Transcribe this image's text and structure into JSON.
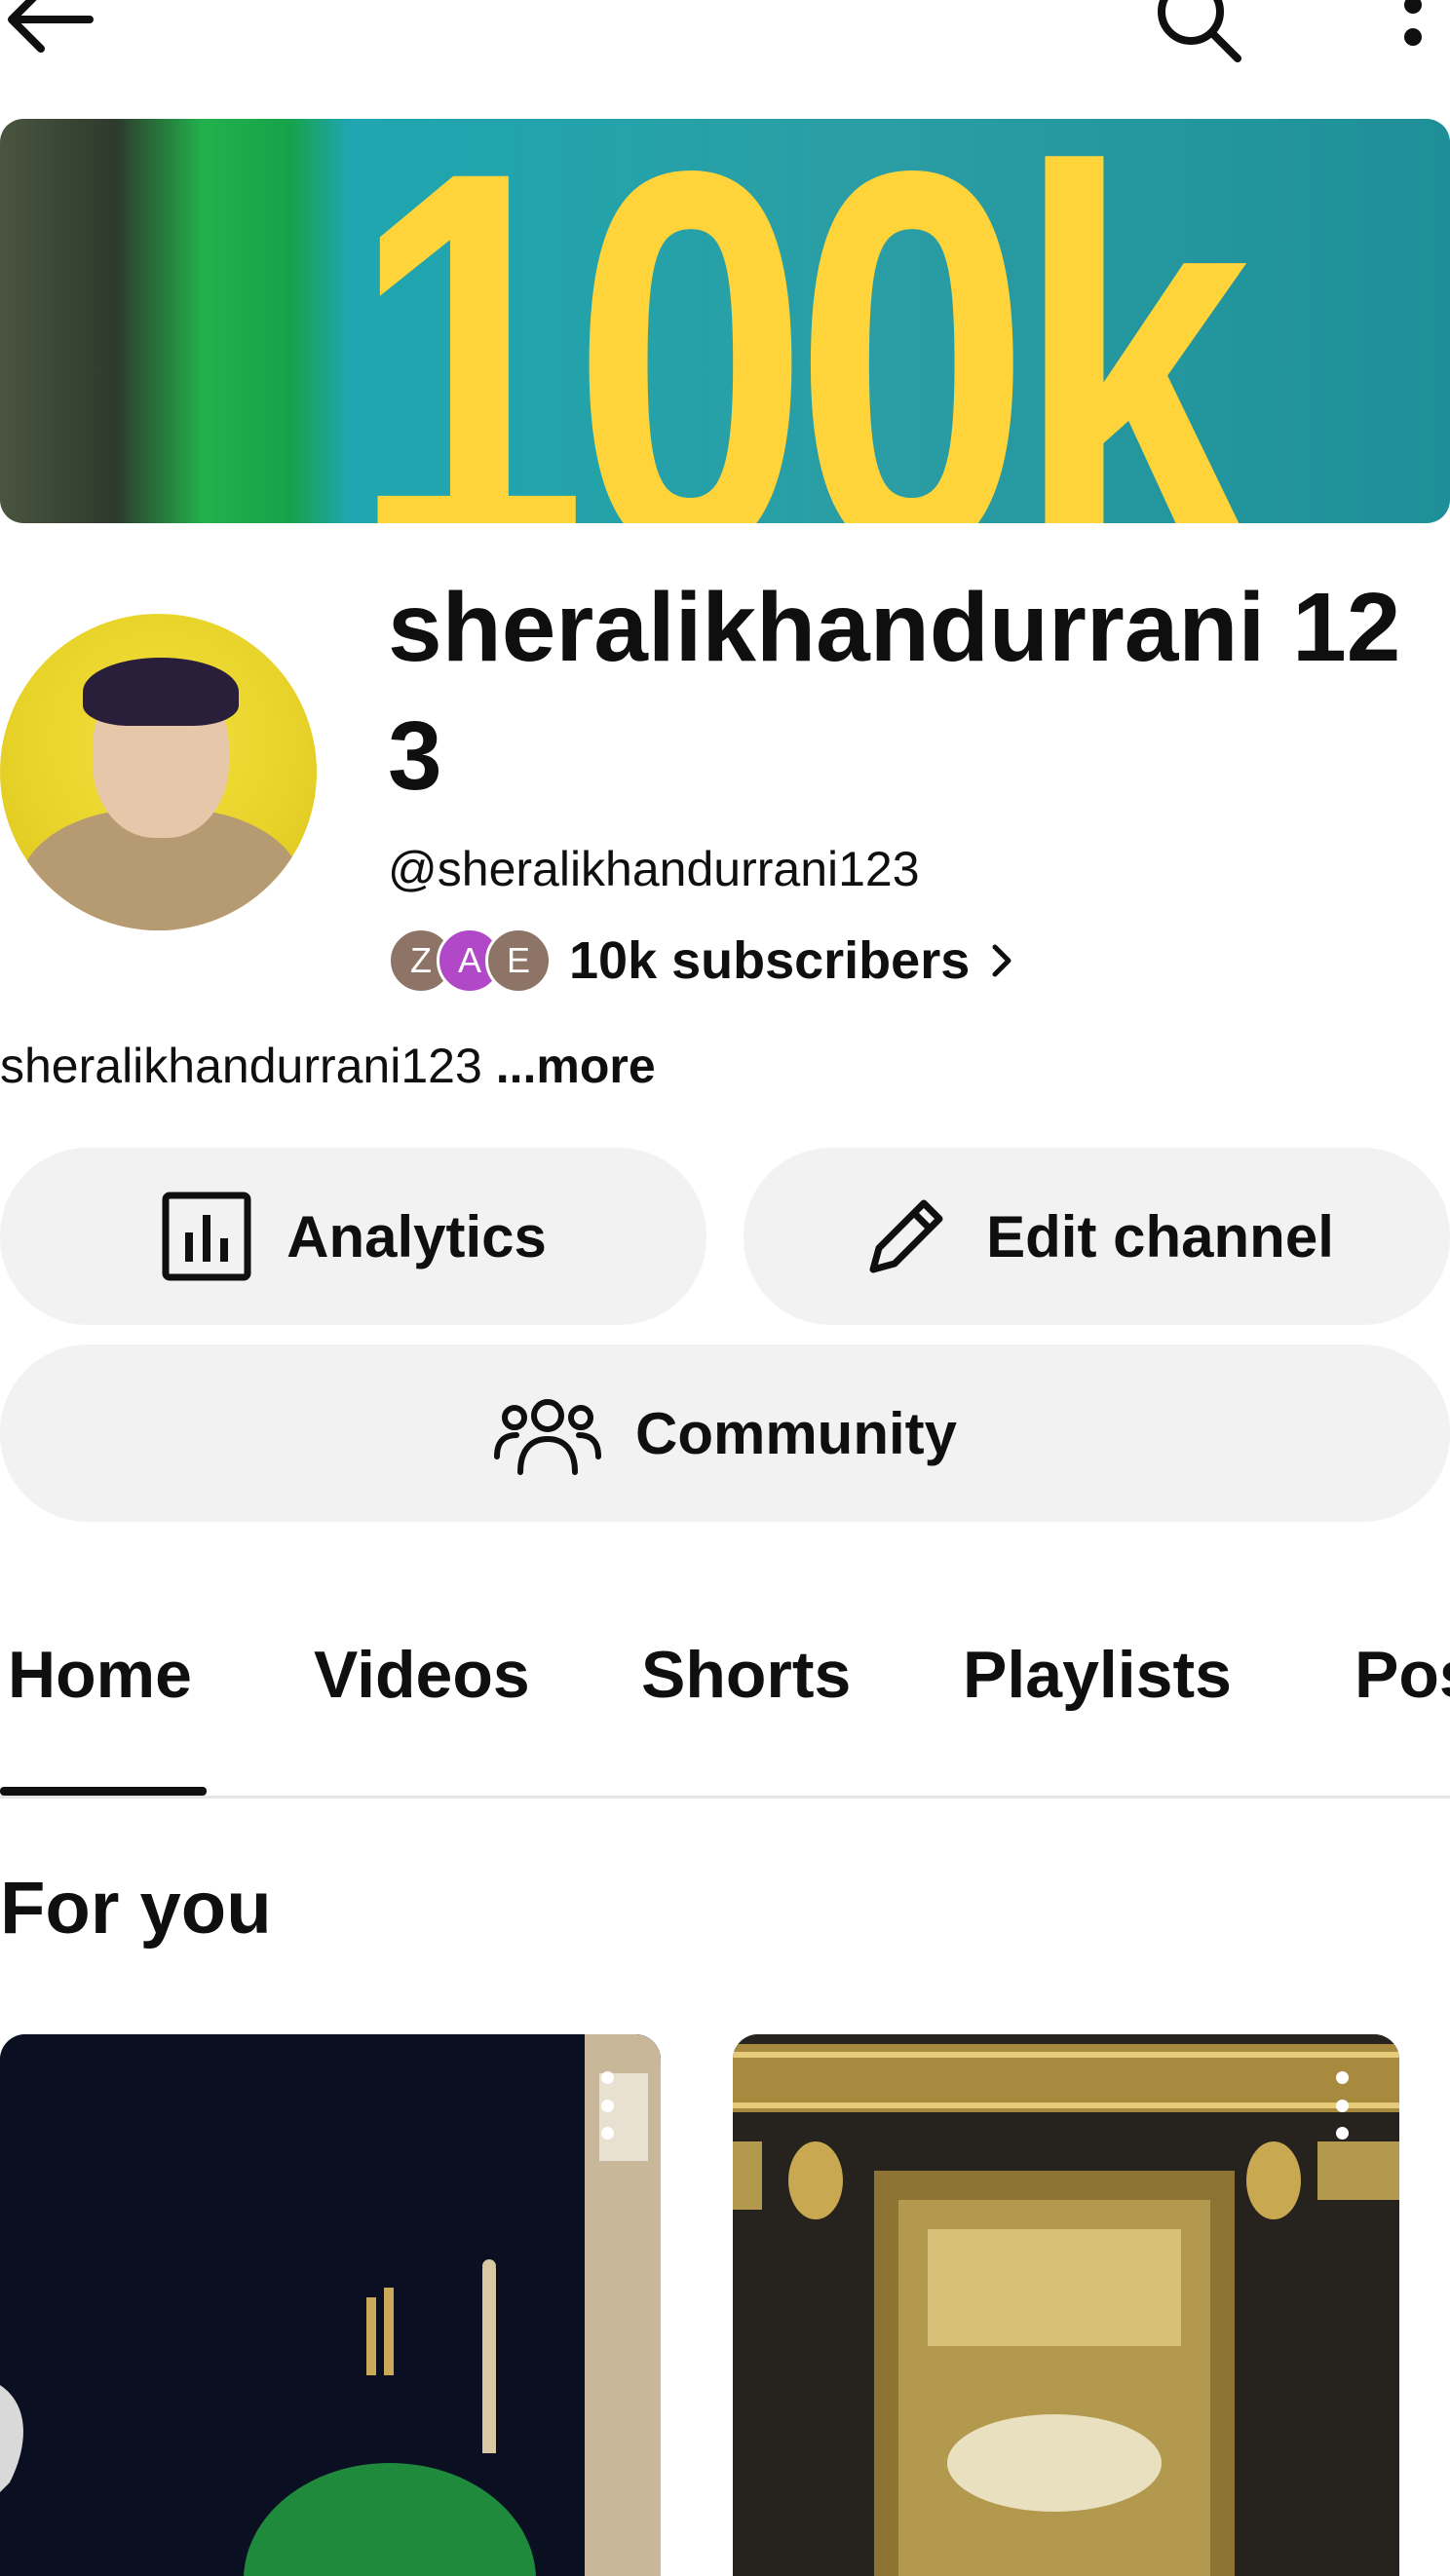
{
  "banner": {
    "text": "100k"
  },
  "channel": {
    "title": "sheralikhandurrani 123",
    "handle": "@sheralikhandurrani123",
    "subscribers": "10k subscribers",
    "description": "sheralikhandurrani123",
    "more_label": "...more",
    "subscriber_avatars": [
      {
        "letter": "Z",
        "color": "#8d7466"
      },
      {
        "letter": "A",
        "color": "#b048c8"
      },
      {
        "letter": "E",
        "color": "#8d7466"
      }
    ]
  },
  "actions": {
    "analytics_label": "Analytics",
    "edit_label": "Edit channel",
    "community_label": "Community"
  },
  "tabs": [
    {
      "label": "Home"
    },
    {
      "label": "Videos"
    },
    {
      "label": "Shorts"
    },
    {
      "label": "Playlists"
    },
    {
      "label": "Posts"
    }
  ],
  "active_tab": "Home",
  "section": {
    "title": "For you"
  },
  "icons": [
    "back-arrow-icon",
    "search-icon",
    "more-vert-icon",
    "analytics-icon",
    "pencil-icon",
    "community-icon",
    "chevron-right-icon"
  ]
}
